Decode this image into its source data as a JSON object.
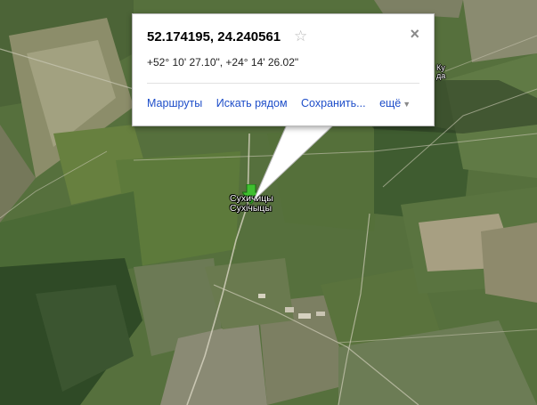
{
  "popup": {
    "decimal_coords": "52.174195, 24.240561",
    "dms_coords": "+52° 10' 27.10\", +24° 14' 26.02\"",
    "star_icon": "star-outline-icon",
    "close_icon": "close-icon",
    "close_glyph": "×",
    "actions": {
      "routes": "Маршруты",
      "search_nearby": "Искать рядом",
      "save": "Сохранить...",
      "more": "ещё"
    }
  },
  "map": {
    "marker_icon": "green-arrow-marker-icon",
    "place_label_ru": "Сухичицы",
    "place_label_be": "Сухічыцы"
  },
  "colors": {
    "link": "#1e4ec9",
    "marker": "#3fbf2f",
    "popup_bg": "#ffffff"
  }
}
